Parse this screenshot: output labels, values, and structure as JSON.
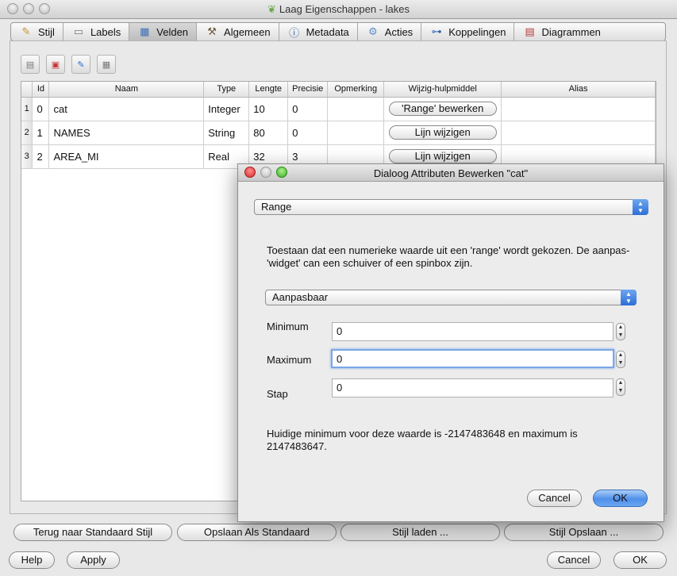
{
  "window": {
    "title": "Laag Eigenschappen - lakes"
  },
  "tabs": [
    {
      "label": "Stijl",
      "icon": "brush-icon"
    },
    {
      "label": "Labels",
      "icon": "label-icon"
    },
    {
      "label": "Velden",
      "icon": "table-icon",
      "active": true
    },
    {
      "label": "Algemeen",
      "icon": "tools-icon"
    },
    {
      "label": "Metadata",
      "icon": "info-icon"
    },
    {
      "label": "Acties",
      "icon": "gears-icon"
    },
    {
      "label": "Koppelingen",
      "icon": "join-icon"
    },
    {
      "label": "Diagrammen",
      "icon": "chart-icon"
    }
  ],
  "table": {
    "headers": [
      "",
      "Id",
      "Naam",
      "Type",
      "Lengte",
      "Precisie",
      "Opmerking",
      "Wijzig-hulpmiddel",
      "Alias"
    ],
    "rows": [
      {
        "row": "1",
        "id": "0",
        "naam": "cat",
        "type": "Integer",
        "lengte": "10",
        "precisie": "0",
        "opmerking": "",
        "edit": "'Range' bewerken",
        "alias": ""
      },
      {
        "row": "2",
        "id": "1",
        "naam": "NAMES",
        "type": "String",
        "lengte": "80",
        "precisie": "0",
        "opmerking": "",
        "edit": "Lijn wijzigen",
        "alias": ""
      },
      {
        "row": "3",
        "id": "2",
        "naam": "AREA_MI",
        "type": "Real",
        "lengte": "32",
        "precisie": "3",
        "opmerking": "",
        "edit": "Lijn wijzigen",
        "alias": ""
      }
    ]
  },
  "bottom": {
    "reset_style": "Terug naar Standaard Stijl",
    "save_default": "Opslaan Als Standaard",
    "load_style": "Stijl laden ...",
    "save_style": "Stijl Opslaan ...",
    "help": "Help",
    "apply": "Apply",
    "cancel": "Cancel",
    "ok": "OK"
  },
  "dialog": {
    "title": "Dialoog Attributen Bewerken \"cat\"",
    "widget_type": "Range",
    "description": "Toestaan dat een numerieke waarde uit een 'range' wordt gekozen. De aanpas-'widget' can een schuiver of een spinbox zijn.",
    "mode": "Aanpasbaar",
    "minimum_label": "Minimum",
    "minimum_value": "0",
    "maximum_label": "Maximum",
    "maximum_value": "0",
    "step_label": "Stap",
    "step_value": "0",
    "info": "Huidige minimum voor deze waarde is -2147483648 en maximum is 2147483647.",
    "cancel": "Cancel",
    "ok": "OK"
  }
}
